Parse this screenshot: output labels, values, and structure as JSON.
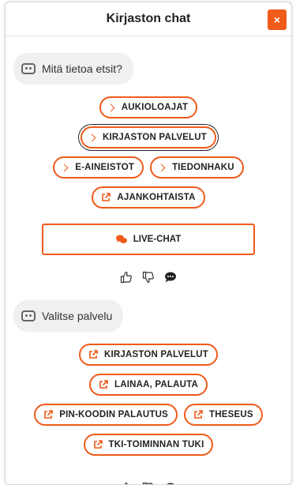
{
  "header": {
    "title": "Kirjaston chat",
    "close_label": "×"
  },
  "colors": {
    "accent": "#f05a1a",
    "bubble": "#f0f0f0"
  },
  "messages": [
    {
      "text": "Mitä tietoa etsit?",
      "options": [
        {
          "label": "AUKIOLOAJAT",
          "icon": "chevron-right-icon"
        },
        {
          "label": "KIRJASTON PALVELUT",
          "icon": "chevron-right-icon",
          "focused": true
        },
        {
          "label": "E-AINEISTOT",
          "icon": "chevron-right-icon"
        },
        {
          "label": "TIEDONHAKU",
          "icon": "chevron-right-icon"
        },
        {
          "label": "AJANKOHTAISTA",
          "icon": "external-link-icon"
        }
      ],
      "live_chat": "LIVE-CHAT"
    },
    {
      "text": "Valitse palvelu",
      "options": [
        {
          "label": "KIRJASTON PALVELUT",
          "icon": "external-link-icon"
        },
        {
          "label": "LAINAA, PALAUTA",
          "icon": "external-link-icon"
        },
        {
          "label": "PIN-KOODIN PALAUTUS",
          "icon": "external-link-icon"
        },
        {
          "label": "THESEUS",
          "icon": "external-link-icon"
        },
        {
          "label": "TKI-TOIMINNAN TUKI",
          "icon": "external-link-icon"
        }
      ]
    }
  ]
}
